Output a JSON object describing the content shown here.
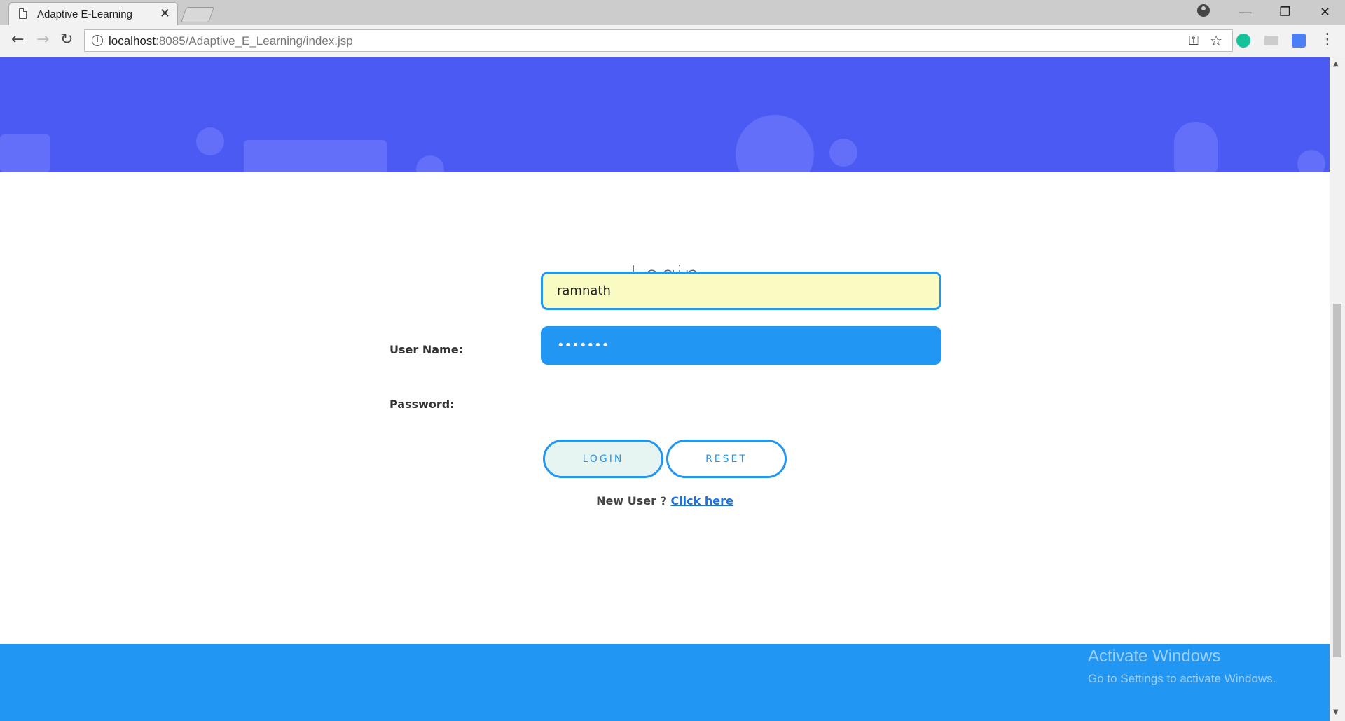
{
  "browser": {
    "tab_title": "Adaptive E-Learning",
    "tab_close": "✕",
    "url_host": "localhost",
    "url_path": ":8085/Adaptive_E_Learning/index.jsp",
    "win_min": "—",
    "win_max": "❐",
    "win_close": "✕"
  },
  "login": {
    "title": "Login",
    "username_label": "User Name:",
    "username_value": "ramnath",
    "password_label": "Password:",
    "password_value": "•••••••",
    "login_button": "LOGIN",
    "reset_button": "RESET",
    "new_user_text": "New User ?",
    "new_user_link": "Click here"
  },
  "watermark": {
    "title": "Activate Windows",
    "subtitle": "Go to Settings to activate Windows."
  },
  "colors": {
    "hero": "#4a5af2",
    "accent": "#2196f3",
    "footer": "#2196f3"
  }
}
